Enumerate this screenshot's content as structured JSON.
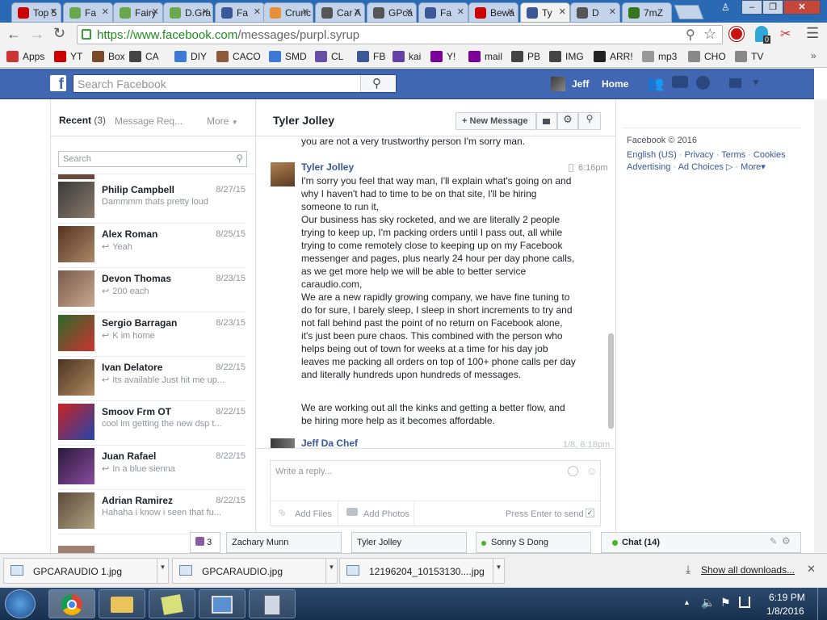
{
  "browser": {
    "tabs": [
      {
        "label": "Top 5",
        "icon_color": "#cc0000",
        "icon": "youtube-icon"
      },
      {
        "label": "Fa",
        "icon_color": "#6aa84f",
        "icon": "swirl-icon"
      },
      {
        "label": "Fairy",
        "icon_color": "#6aa84f",
        "icon": "swirl-icon"
      },
      {
        "label": "D.Gra",
        "icon_color": "#6aa84f",
        "icon": "swirl-icon"
      },
      {
        "label": "Fa",
        "icon_color": "#3b5998",
        "icon": "facebook-icon"
      },
      {
        "label": "Crunc",
        "icon_color": "#e69138",
        "icon": "crunchyroll-icon"
      },
      {
        "label": "Car A",
        "icon_color": "#555555",
        "icon": "gp-icon"
      },
      {
        "label": "GPca",
        "icon_color": "#555555",
        "icon": "gp-icon"
      },
      {
        "label": "Fa",
        "icon_color": "#3b5998",
        "icon": "facebook-icon"
      },
      {
        "label": "Bewa",
        "icon_color": "#cc0000",
        "icon": "bewa-icon"
      },
      {
        "label": "Ty",
        "icon_color": "#3b5998",
        "icon": "facebook-icon"
      },
      {
        "label": "D",
        "icon_color": "#555555",
        "icon": "gp-icon"
      },
      {
        "label": "7mZ",
        "icon_color": "#38761d",
        "icon": "square-icon"
      }
    ],
    "url_host": "https://www.facebook.com",
    "url_path": "/messages/purpl.syrup",
    "bookmarks": [
      {
        "label": "Apps",
        "icon": "apps-icon",
        "color": "#cc3333"
      },
      {
        "label": "YT",
        "icon": "youtube-icon",
        "color": "#cc0000"
      },
      {
        "label": "Box",
        "icon": "box-icon",
        "color": "#7a4b2a"
      },
      {
        "label": "CA",
        "icon": "gp-icon",
        "color": "#444444"
      },
      {
        "label": "DIY",
        "icon": "diy-icon",
        "color": "#3c78d8"
      },
      {
        "label": "CACO",
        "icon": "caco-icon",
        "color": "#8a5a3a"
      },
      {
        "label": "SMD",
        "icon": "smd-icon",
        "color": "#3c78d8"
      },
      {
        "label": "CL",
        "icon": "peace-icon",
        "color": "#674ea7"
      },
      {
        "label": "FB",
        "icon": "facebook-icon",
        "color": "#3b5998"
      },
      {
        "label": "kai",
        "icon": "twitch-icon",
        "color": "#6441a5"
      },
      {
        "label": "Y!",
        "icon": "yahoo-icon",
        "color": "#7b0099"
      },
      {
        "label": "mail",
        "icon": "mail-icon",
        "color": "#7b0099"
      },
      {
        "label": "PB",
        "icon": "camera-icon",
        "color": "#444444"
      },
      {
        "label": "IMG",
        "icon": "img-icon",
        "color": "#444444"
      },
      {
        "label": "ARR!",
        "icon": "pirate-icon",
        "color": "#222222"
      },
      {
        "label": "mp3",
        "icon": "mp3-icon",
        "color": "#999999"
      },
      {
        "label": "CHO",
        "icon": "page-icon",
        "color": "#888888"
      },
      {
        "label": "TV",
        "icon": "page-icon",
        "color": "#888888"
      }
    ]
  },
  "fb": {
    "search_placeholder": "Search Facebook",
    "user_name": "Jeff",
    "home_label": "Home",
    "brand_color": "#4267b2"
  },
  "inbox": {
    "recent_label": "Recent",
    "recent_count": "(3)",
    "requests_label": "Message Req...",
    "more_label": "More",
    "search_placeholder": "Search",
    "conversations": [
      {
        "name": "Philip Campbell",
        "date": "8/27/15",
        "preview": "Dammmm thats pretty loud",
        "reply": false
      },
      {
        "name": "Alex Roman",
        "date": "8/25/15",
        "preview": "Yeah",
        "reply": true
      },
      {
        "name": "Devon Thomas",
        "date": "8/23/15",
        "preview": "200 each",
        "reply": true
      },
      {
        "name": "Sergio Barragan",
        "date": "8/23/15",
        "preview": "K im home",
        "reply": true
      },
      {
        "name": "Ivan Delatore",
        "date": "8/22/15",
        "preview": "Its available Just hit me up...",
        "reply": true
      },
      {
        "name": "Smoov Frm OT",
        "date": "8/22/15",
        "preview": "cool im getting the new dsp t...",
        "reply": false
      },
      {
        "name": "Juan Rafael",
        "date": "8/22/15",
        "preview": "In a blue sienna",
        "reply": true
      },
      {
        "name": "Adrian Ramirez",
        "date": "8/22/15",
        "preview": "Hahaha i know i seen that fu...",
        "reply": false
      }
    ]
  },
  "thread": {
    "title": "Tyler Jolley",
    "new_message_label": "New Message",
    "cutoff_text": "you are not a very trustworthy person I'm sorry man.",
    "sender": "Tyler Jolley",
    "time": "6:16pm",
    "para1": "I'm sorry you feel that way man, I'll explain what's going on and why I haven't had to time to be on that site, I'll be hiring someone to run it,",
    "para2": "Our business has sky rocketed, and we are literally 2 people trying to keep up,  I'm packing orders until I pass out, all while trying to come remotely close to keeping up on my Facebook messenger and pages, plus nearly 24 hour per day phone calls, as we get more help we will be able to better service caraudio.com,",
    "para3": "We are a new rapidly growing company, we have fine tuning to do for sure, I barely sleep, I sleep in short increments to try and not fall behind past the point of no return on Facebook alone, it's just been pure chaos. This combined with the person who helps being out of town for weeks at a time for his day job leaves me packing all orders on top of 100+ phone calls per day and literally hundreds upon hundreds of messages.",
    "para4": "We are working out all the kinks and getting a better flow, and be hiring more help as it becomes affordable.",
    "next_sender": "Jeff Da Chef",
    "next_time": "1/8, 6:18pm",
    "reply_placeholder": "Write a reply...",
    "add_files_label": "Add Files",
    "add_photos_label": "Add Photos",
    "enter_to_send_label": "Press Enter to send"
  },
  "sidebar": {
    "copyright": "Facebook © 2016",
    "links_row1": [
      "English (US)",
      "Privacy",
      "Terms",
      "Cookies"
    ],
    "links_row2": [
      "Advertising",
      "Ad Choices",
      "More"
    ]
  },
  "chatbar": {
    "tab_count": "3",
    "tabs": [
      "Zachary Munn",
      "Tyler Jolley",
      "Sonny S Dong"
    ],
    "chat_label": "Chat (14)"
  },
  "downloads": {
    "items": [
      "GPCARAUDIO 1.jpg",
      "GPCARAUDIO.jpg",
      "12196204_10153130....jpg"
    ],
    "show_all_label": "Show all downloads..."
  },
  "taskbar": {
    "time": "6:19 PM",
    "date": "1/8/2016"
  }
}
